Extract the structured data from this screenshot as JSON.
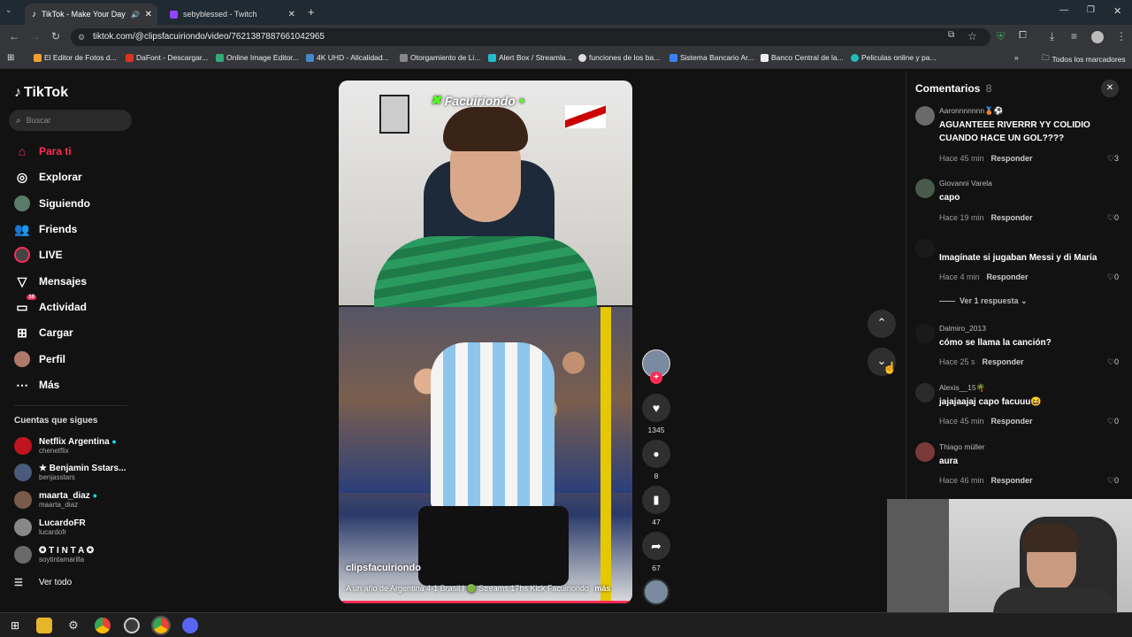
{
  "browser": {
    "tabs": [
      {
        "label": "TikTok - Make Your Day",
        "active": true
      },
      {
        "label": "sebyblessed - Twitch",
        "active": false
      }
    ],
    "url": "tiktok.com/@clipsfacuiriondo/video/7621387887661042965",
    "bookmarks": [
      "El Editor de Fotos d...",
      "DaFont - Descargar...",
      "Online Image Editor...",
      "4K UHD - Allcalidad...",
      "Otorgamiento de Li...",
      "Alert Box / Streamla...",
      "funciones de los ba...",
      "Sistema Bancario Ar...",
      "Banco Central de la...",
      "Peliculas online y pa..."
    ],
    "bookmarks_all": "Todos los marcadores"
  },
  "sidebar": {
    "logo": "TikTok",
    "search_placeholder": "Buscar",
    "nav": [
      {
        "label": "Para ti",
        "icon": "home-icon",
        "active": true
      },
      {
        "label": "Explorar",
        "icon": "compass-icon"
      },
      {
        "label": "Siguiendo",
        "icon": "following-icon"
      },
      {
        "label": "Friends",
        "icon": "friends-icon"
      },
      {
        "label": "LIVE",
        "icon": "live-icon"
      },
      {
        "label": "Mensajes",
        "icon": "messages-icon"
      },
      {
        "label": "Actividad",
        "icon": "activity-icon",
        "badge": "10"
      },
      {
        "label": "Cargar",
        "icon": "upload-icon"
      },
      {
        "label": "Perfil",
        "icon": "profile-icon"
      },
      {
        "label": "Más",
        "icon": "more-icon"
      }
    ],
    "following_title": "Cuentas que sigues",
    "following": [
      {
        "name": "Netflix Argentina",
        "handle": "chenetflix",
        "verified": true
      },
      {
        "name": "★ Benjamin Sstars...",
        "handle": "benjasstars"
      },
      {
        "name": "maarta_diaz",
        "handle": "maarta_diaz",
        "verified": true
      },
      {
        "name": "LucardoFR",
        "handle": "lucardofr"
      },
      {
        "name": "✪ T I N T A ✪",
        "handle": "soytintamarilla"
      }
    ],
    "see_all": "Ver todo"
  },
  "video": {
    "overlay_name": "Facuiriondo",
    "author": "clipsfacuiriondo",
    "caption": "A un año de Argentina 4-1 Brasil I 🟢 Streams 17hs Kick Facuiriondo",
    "more": "más",
    "likes": "1345",
    "comments": "8",
    "saves": "47",
    "shares": "67"
  },
  "comments": {
    "title": "Comentarios",
    "count": "8",
    "reply_label": "Responder",
    "view_replies": "Ver 1 respuesta",
    "items": [
      {
        "user": "Aaronnnnnnn🥉⚽",
        "text": "AGUANTEEE RIVERRR YY COLIDIO CUANDO HACE UN GOL????",
        "time": "Hace 45 min",
        "likes": "3"
      },
      {
        "user": "Giovanni Varela",
        "text": "capo",
        "time": "Hace 19 min",
        "likes": "0"
      },
      {
        "user": "",
        "text": "Imagínate si jugaban Messi y di María",
        "time": "Hace 4 min",
        "likes": "0"
      },
      {
        "user": "Dalmiro_2013",
        "text": "cómo se llama la canción?",
        "time": "Hace 25 s",
        "likes": "0"
      },
      {
        "user": "Alexis__15🌴",
        "text": "jajajaajaj capo facuuu😆",
        "time": "Hace 45 min",
        "likes": "0"
      },
      {
        "user": "Thiago müller",
        "text": "aura",
        "time": "Hace 46 min",
        "likes": "0"
      }
    ]
  },
  "colors": {
    "accent": "#fe2c55",
    "bg": "#121212"
  }
}
